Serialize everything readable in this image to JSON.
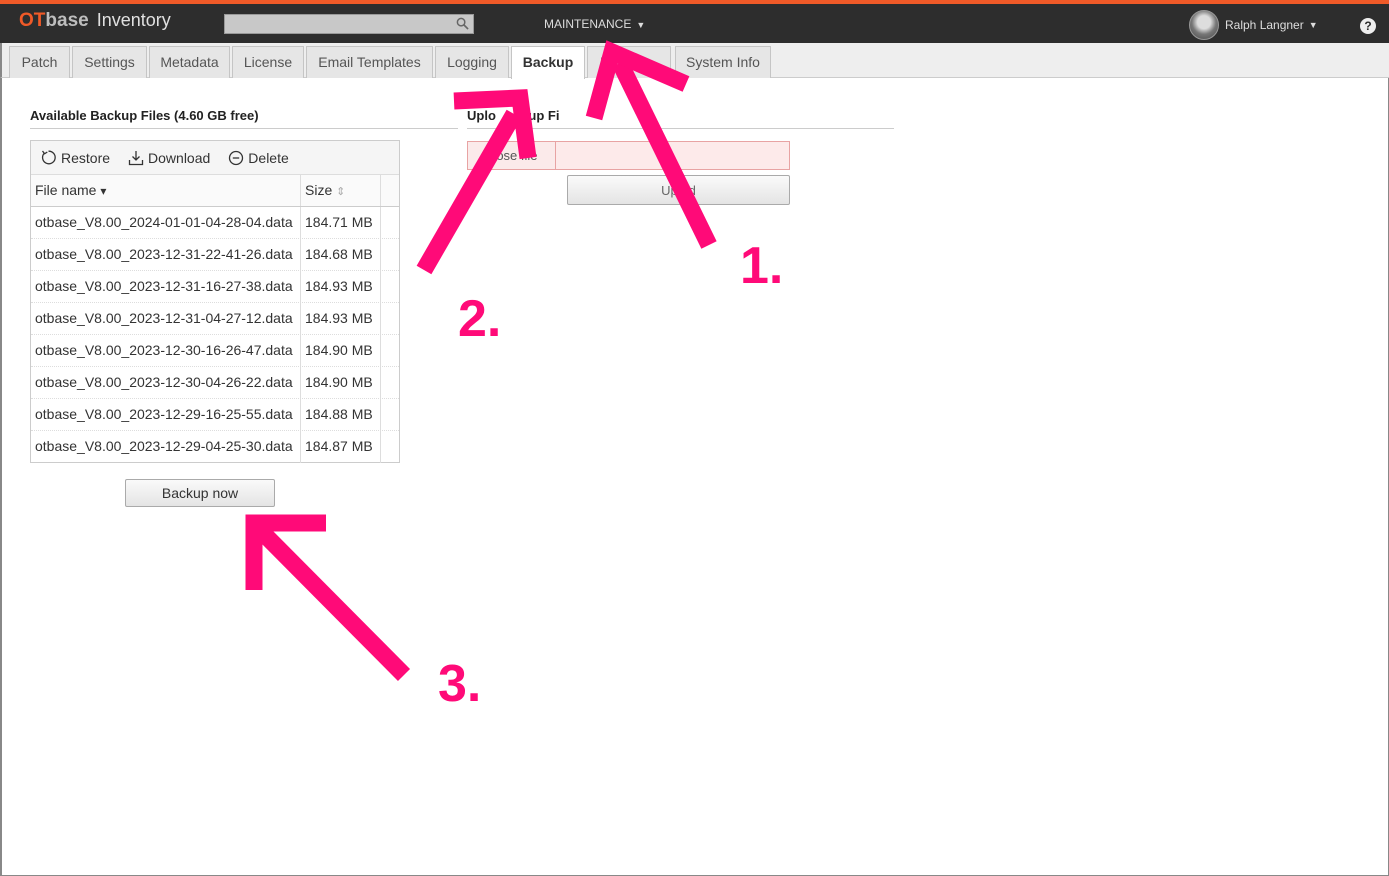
{
  "header": {
    "logo_ot": "OT",
    "logo_base": "base",
    "logo_product": "Inventory",
    "search_placeholder": "",
    "menu_label": "MAINTENANCE",
    "menu_caret": "▼",
    "user_name": "Ralph Langner",
    "user_caret": "▼",
    "help_label": "?"
  },
  "tabs": [
    {
      "label": "Patch"
    },
    {
      "label": "Settings"
    },
    {
      "label": "Metadata"
    },
    {
      "label": "License"
    },
    {
      "label": "Email Templates"
    },
    {
      "label": "Logging"
    },
    {
      "label": "Backup",
      "active": true
    },
    {
      "label": "D"
    },
    {
      "label": "System Info"
    }
  ],
  "available": {
    "title": "Available Backup Files (4.60 GB free)",
    "toolbar": {
      "restore": "Restore",
      "download": "Download",
      "delete": "Delete"
    },
    "columns": {
      "name": "File name",
      "name_sort": "▾",
      "size": "Size",
      "size_sort": "⇕"
    },
    "rows": [
      {
        "name": "otbase_V8.00_2024-01-01-04-28-04.data",
        "size": "184.71 MB"
      },
      {
        "name": "otbase_V8.00_2023-12-31-22-41-26.data",
        "size": "184.68 MB"
      },
      {
        "name": "otbase_V8.00_2023-12-31-16-27-38.data",
        "size": "184.93 MB"
      },
      {
        "name": "otbase_V8.00_2023-12-31-04-27-12.data",
        "size": "184.93 MB"
      },
      {
        "name": "otbase_V8.00_2023-12-30-16-26-47.data",
        "size": "184.90 MB"
      },
      {
        "name": "otbase_V8.00_2023-12-30-04-26-22.data",
        "size": "184.90 MB"
      },
      {
        "name": "otbase_V8.00_2023-12-29-16-25-55.data",
        "size": "184.88 MB"
      },
      {
        "name": "otbase_V8.00_2023-12-29-04-25-30.data",
        "size": "184.87 MB"
      }
    ],
    "backup_now": "Backup now"
  },
  "upload": {
    "title": "Uplo   ackup Fi",
    "choose_label": "   ose file",
    "upload_label": "Up   d"
  },
  "annotations": {
    "one": "1.",
    "two": "2.",
    "three": "3.",
    "color": "#ff0a78"
  },
  "colors": {
    "accent": "#f05a28",
    "topbar": "#2d2d2d"
  }
}
